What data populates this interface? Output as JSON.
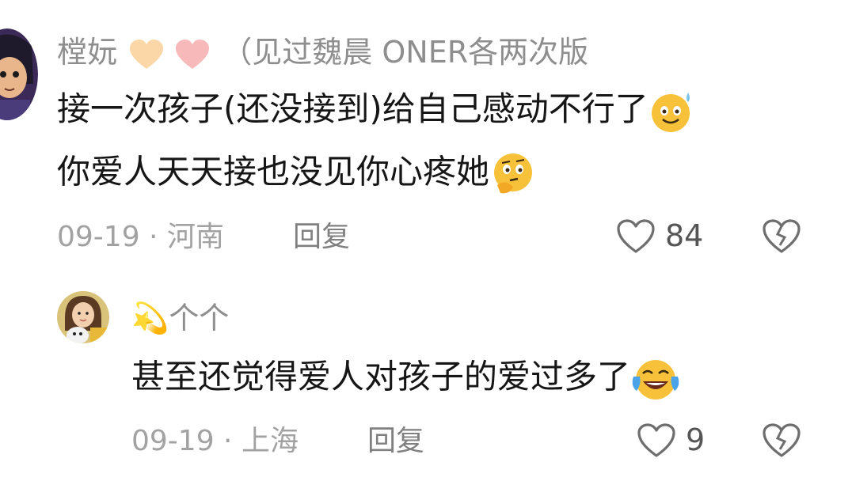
{
  "comments": [
    {
      "user": {
        "name": "樘妧",
        "hearts": [
          "peach-heart",
          "pink-heart"
        ],
        "name_suffix": "（见过魏晨 ONER各两次版",
        "avatar": "cartoon-girl-avatar"
      },
      "lines": [
        "接一次孩子(还没接到)给自己感动不行了",
        "你爱人天天接也没见你心疼她"
      ],
      "line_emojis": [
        "sweat-smile-emoji",
        "thinking-emoji"
      ],
      "date": "09-19 · 河南",
      "reply_label": "回复",
      "like_count": "84",
      "like_icon": "heart-outline-icon",
      "dislike_icon": "broken-heart-icon"
    },
    {
      "user": {
        "name": "💫个个",
        "avatar": "girl-with-dog-avatar"
      },
      "lines": [
        "甚至还觉得爱人对孩子的爱过多了"
      ],
      "line_emojis": [
        "laughing-crying-emoji"
      ],
      "date": "09-19 · 上海",
      "reply_label": "回复",
      "like_count": "9",
      "like_icon": "heart-outline-icon",
      "dislike_icon": "broken-heart-icon"
    }
  ],
  "colors": {
    "name_gray": "#8e8e8e",
    "meta_gray": "#a2a2a2",
    "text": "#161616",
    "emoji_yellow": "#f8c13a"
  }
}
